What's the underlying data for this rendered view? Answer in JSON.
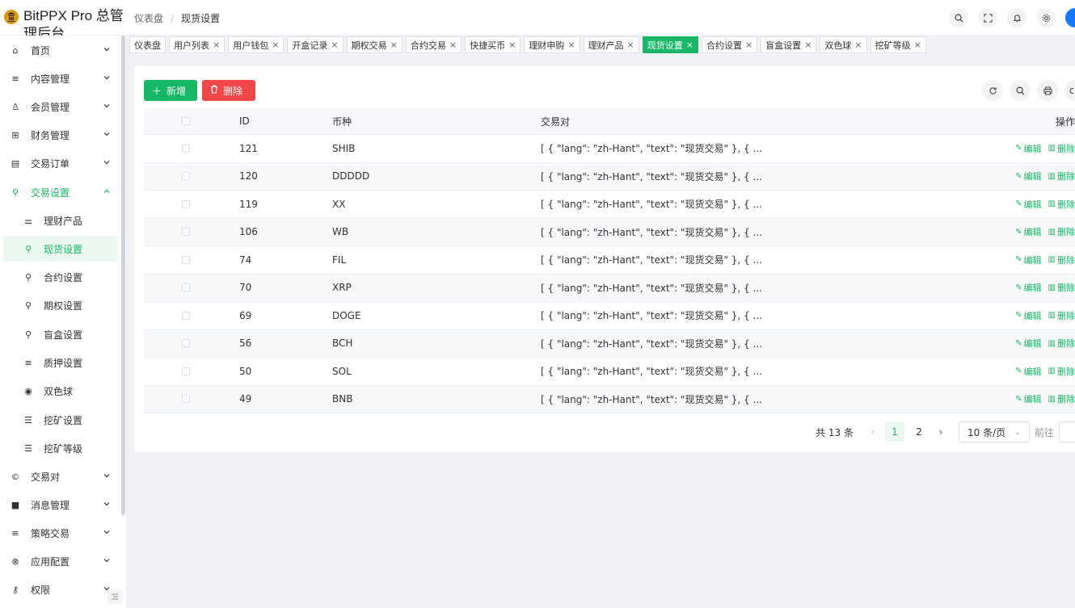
{
  "app": {
    "title": "BitPPX Pro 总管理后台"
  },
  "breadcrumb": {
    "parent": "仪表盘",
    "current": "现货设置"
  },
  "sidebar": {
    "items": [
      {
        "label": "首页",
        "icon": "home-icon",
        "glyph": "⌂",
        "arrow": "down"
      },
      {
        "label": "内容管理",
        "icon": "list-icon",
        "glyph": "≡",
        "arrow": "down"
      },
      {
        "label": "会员管理",
        "icon": "user-icon",
        "glyph": "♙",
        "arrow": "down"
      },
      {
        "label": "财务管理",
        "icon": "finance-icon",
        "glyph": "⊞",
        "arrow": "down"
      },
      {
        "label": "交易订单",
        "icon": "order-icon",
        "glyph": "▤",
        "arrow": "down"
      },
      {
        "label": "交易设置",
        "icon": "wrench-icon",
        "glyph": "⚲",
        "arrow": "up"
      },
      {
        "label": "理财产品",
        "icon": "filter-icon",
        "glyph": "⚌",
        "sub": true
      },
      {
        "label": "现货设置",
        "icon": "wrench-icon",
        "glyph": "⚲",
        "sub": true,
        "active": true
      },
      {
        "label": "合约设置",
        "icon": "wrench-icon",
        "glyph": "⚲",
        "sub": true
      },
      {
        "label": "期权设置",
        "icon": "wrench-icon",
        "glyph": "⚲",
        "sub": true
      },
      {
        "label": "盲盒设置",
        "icon": "wrench-icon",
        "glyph": "⚲",
        "sub": true
      },
      {
        "label": "质押设置",
        "icon": "list-icon",
        "glyph": "≡",
        "sub": true
      },
      {
        "label": "双色球",
        "icon": "target-icon",
        "glyph": "◉",
        "sub": true
      },
      {
        "label": "挖矿设置",
        "icon": "stack-icon",
        "glyph": "☰",
        "sub": true
      },
      {
        "label": "挖矿等级",
        "icon": "stack-icon",
        "glyph": "☰",
        "sub": true
      },
      {
        "label": "交易对",
        "icon": "copyright-icon",
        "glyph": "©",
        "arrow": "down"
      },
      {
        "label": "消息管理",
        "icon": "message-icon",
        "glyph": "■",
        "arrow": "down"
      },
      {
        "label": "策略交易",
        "icon": "menu-icon",
        "glyph": "≡",
        "arrow": "down"
      },
      {
        "label": "应用配置",
        "icon": "config-icon",
        "glyph": "⊗",
        "arrow": "down"
      },
      {
        "label": "权限",
        "icon": "key-icon",
        "glyph": "⚷",
        "arrow": "down"
      }
    ]
  },
  "tabs": [
    {
      "label": "仪表盘",
      "closable": false
    },
    {
      "label": "用户列表",
      "closable": true
    },
    {
      "label": "用户钱包",
      "closable": true
    },
    {
      "label": "开盒记录",
      "closable": true
    },
    {
      "label": "期权交易",
      "closable": true
    },
    {
      "label": "合约交易",
      "closable": true
    },
    {
      "label": "快捷买币",
      "closable": true
    },
    {
      "label": "理财申购",
      "closable": true
    },
    {
      "label": "理财产品",
      "closable": true
    },
    {
      "label": "现货设置",
      "closable": true,
      "active": true
    },
    {
      "label": "合约设置",
      "closable": true
    },
    {
      "label": "盲盒设置",
      "closable": true
    },
    {
      "label": "双色球",
      "closable": true
    },
    {
      "label": "挖矿等级",
      "closable": true
    }
  ],
  "toolbar": {
    "add_label": "新增",
    "delete_label": "删除"
  },
  "table": {
    "columns": {
      "id": "ID",
      "coin": "币种",
      "pair": "交易对",
      "ops": "操作"
    },
    "edit_label": "编辑",
    "delete_label": "删除",
    "rows": [
      {
        "id": "121",
        "coin": "SHIB",
        "pair": "[ { \"lang\": \"zh-Hant\", \"text\": \"现货交易\" }, { ..."
      },
      {
        "id": "120",
        "coin": "DDDDD",
        "pair": "[ { \"lang\": \"zh-Hant\", \"text\": \"现货交易\" }, { ..."
      },
      {
        "id": "119",
        "coin": "XX",
        "pair": "[ { \"lang\": \"zh-Hant\", \"text\": \"现货交易\" }, { ..."
      },
      {
        "id": "106",
        "coin": "WB",
        "pair": "[ { \"lang\": \"zh-Hant\", \"text\": \"现货交易\" }, { ..."
      },
      {
        "id": "74",
        "coin": "FIL",
        "pair": "[ { \"lang\": \"zh-Hant\", \"text\": \"现货交易\" }, { ..."
      },
      {
        "id": "70",
        "coin": "XRP",
        "pair": "[ { \"lang\": \"zh-Hant\", \"text\": \"现货交易\" }, { ..."
      },
      {
        "id": "69",
        "coin": "DOGE",
        "pair": "[ { \"lang\": \"zh-Hant\", \"text\": \"现货交易\" }, { ..."
      },
      {
        "id": "56",
        "coin": "BCH",
        "pair": "[ { \"lang\": \"zh-Hant\", \"text\": \"现货交易\" }, { ..."
      },
      {
        "id": "50",
        "coin": "SOL",
        "pair": "[ { \"lang\": \"zh-Hant\", \"text\": \"现货交易\" }, { ..."
      },
      {
        "id": "49",
        "coin": "BNB",
        "pair": "[ { \"lang\": \"zh-Hant\", \"text\": \"现货交易\" }, { ..."
      }
    ]
  },
  "pagination": {
    "total_text": "共 13 条",
    "pages": [
      "1",
      "2"
    ],
    "current_page": "1",
    "page_size": "10 条/页",
    "goto_label": "前往"
  },
  "colors": {
    "accent": "#16b765",
    "danger": "#f04848",
    "logo": "#d89b12"
  }
}
